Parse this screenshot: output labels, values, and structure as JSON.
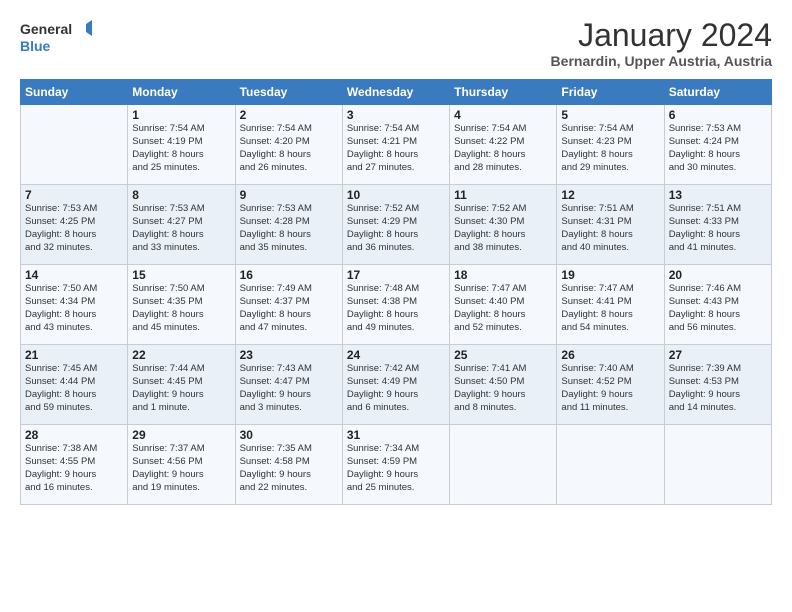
{
  "header": {
    "logo_line1": "General",
    "logo_line2": "Blue",
    "main_title": "January 2024",
    "subtitle": "Bernardin, Upper Austria, Austria"
  },
  "weekdays": [
    "Sunday",
    "Monday",
    "Tuesday",
    "Wednesday",
    "Thursday",
    "Friday",
    "Saturday"
  ],
  "weeks": [
    [
      {
        "day": "",
        "info": ""
      },
      {
        "day": "1",
        "info": "Sunrise: 7:54 AM\nSunset: 4:19 PM\nDaylight: 8 hours\nand 25 minutes."
      },
      {
        "day": "2",
        "info": "Sunrise: 7:54 AM\nSunset: 4:20 PM\nDaylight: 8 hours\nand 26 minutes."
      },
      {
        "day": "3",
        "info": "Sunrise: 7:54 AM\nSunset: 4:21 PM\nDaylight: 8 hours\nand 27 minutes."
      },
      {
        "day": "4",
        "info": "Sunrise: 7:54 AM\nSunset: 4:22 PM\nDaylight: 8 hours\nand 28 minutes."
      },
      {
        "day": "5",
        "info": "Sunrise: 7:54 AM\nSunset: 4:23 PM\nDaylight: 8 hours\nand 29 minutes."
      },
      {
        "day": "6",
        "info": "Sunrise: 7:53 AM\nSunset: 4:24 PM\nDaylight: 8 hours\nand 30 minutes."
      }
    ],
    [
      {
        "day": "7",
        "info": "Sunrise: 7:53 AM\nSunset: 4:25 PM\nDaylight: 8 hours\nand 32 minutes."
      },
      {
        "day": "8",
        "info": "Sunrise: 7:53 AM\nSunset: 4:27 PM\nDaylight: 8 hours\nand 33 minutes."
      },
      {
        "day": "9",
        "info": "Sunrise: 7:53 AM\nSunset: 4:28 PM\nDaylight: 8 hours\nand 35 minutes."
      },
      {
        "day": "10",
        "info": "Sunrise: 7:52 AM\nSunset: 4:29 PM\nDaylight: 8 hours\nand 36 minutes."
      },
      {
        "day": "11",
        "info": "Sunrise: 7:52 AM\nSunset: 4:30 PM\nDaylight: 8 hours\nand 38 minutes."
      },
      {
        "day": "12",
        "info": "Sunrise: 7:51 AM\nSunset: 4:31 PM\nDaylight: 8 hours\nand 40 minutes."
      },
      {
        "day": "13",
        "info": "Sunrise: 7:51 AM\nSunset: 4:33 PM\nDaylight: 8 hours\nand 41 minutes."
      }
    ],
    [
      {
        "day": "14",
        "info": "Sunrise: 7:50 AM\nSunset: 4:34 PM\nDaylight: 8 hours\nand 43 minutes."
      },
      {
        "day": "15",
        "info": "Sunrise: 7:50 AM\nSunset: 4:35 PM\nDaylight: 8 hours\nand 45 minutes."
      },
      {
        "day": "16",
        "info": "Sunrise: 7:49 AM\nSunset: 4:37 PM\nDaylight: 8 hours\nand 47 minutes."
      },
      {
        "day": "17",
        "info": "Sunrise: 7:48 AM\nSunset: 4:38 PM\nDaylight: 8 hours\nand 49 minutes."
      },
      {
        "day": "18",
        "info": "Sunrise: 7:47 AM\nSunset: 4:40 PM\nDaylight: 8 hours\nand 52 minutes."
      },
      {
        "day": "19",
        "info": "Sunrise: 7:47 AM\nSunset: 4:41 PM\nDaylight: 8 hours\nand 54 minutes."
      },
      {
        "day": "20",
        "info": "Sunrise: 7:46 AM\nSunset: 4:43 PM\nDaylight: 8 hours\nand 56 minutes."
      }
    ],
    [
      {
        "day": "21",
        "info": "Sunrise: 7:45 AM\nSunset: 4:44 PM\nDaylight: 8 hours\nand 59 minutes."
      },
      {
        "day": "22",
        "info": "Sunrise: 7:44 AM\nSunset: 4:45 PM\nDaylight: 9 hours\nand 1 minute."
      },
      {
        "day": "23",
        "info": "Sunrise: 7:43 AM\nSunset: 4:47 PM\nDaylight: 9 hours\nand 3 minutes."
      },
      {
        "day": "24",
        "info": "Sunrise: 7:42 AM\nSunset: 4:49 PM\nDaylight: 9 hours\nand 6 minutes."
      },
      {
        "day": "25",
        "info": "Sunrise: 7:41 AM\nSunset: 4:50 PM\nDaylight: 9 hours\nand 8 minutes."
      },
      {
        "day": "26",
        "info": "Sunrise: 7:40 AM\nSunset: 4:52 PM\nDaylight: 9 hours\nand 11 minutes."
      },
      {
        "day": "27",
        "info": "Sunrise: 7:39 AM\nSunset: 4:53 PM\nDaylight: 9 hours\nand 14 minutes."
      }
    ],
    [
      {
        "day": "28",
        "info": "Sunrise: 7:38 AM\nSunset: 4:55 PM\nDaylight: 9 hours\nand 16 minutes."
      },
      {
        "day": "29",
        "info": "Sunrise: 7:37 AM\nSunset: 4:56 PM\nDaylight: 9 hours\nand 19 minutes."
      },
      {
        "day": "30",
        "info": "Sunrise: 7:35 AM\nSunset: 4:58 PM\nDaylight: 9 hours\nand 22 minutes."
      },
      {
        "day": "31",
        "info": "Sunrise: 7:34 AM\nSunset: 4:59 PM\nDaylight: 9 hours\nand 25 minutes."
      },
      {
        "day": "",
        "info": ""
      },
      {
        "day": "",
        "info": ""
      },
      {
        "day": "",
        "info": ""
      }
    ]
  ]
}
